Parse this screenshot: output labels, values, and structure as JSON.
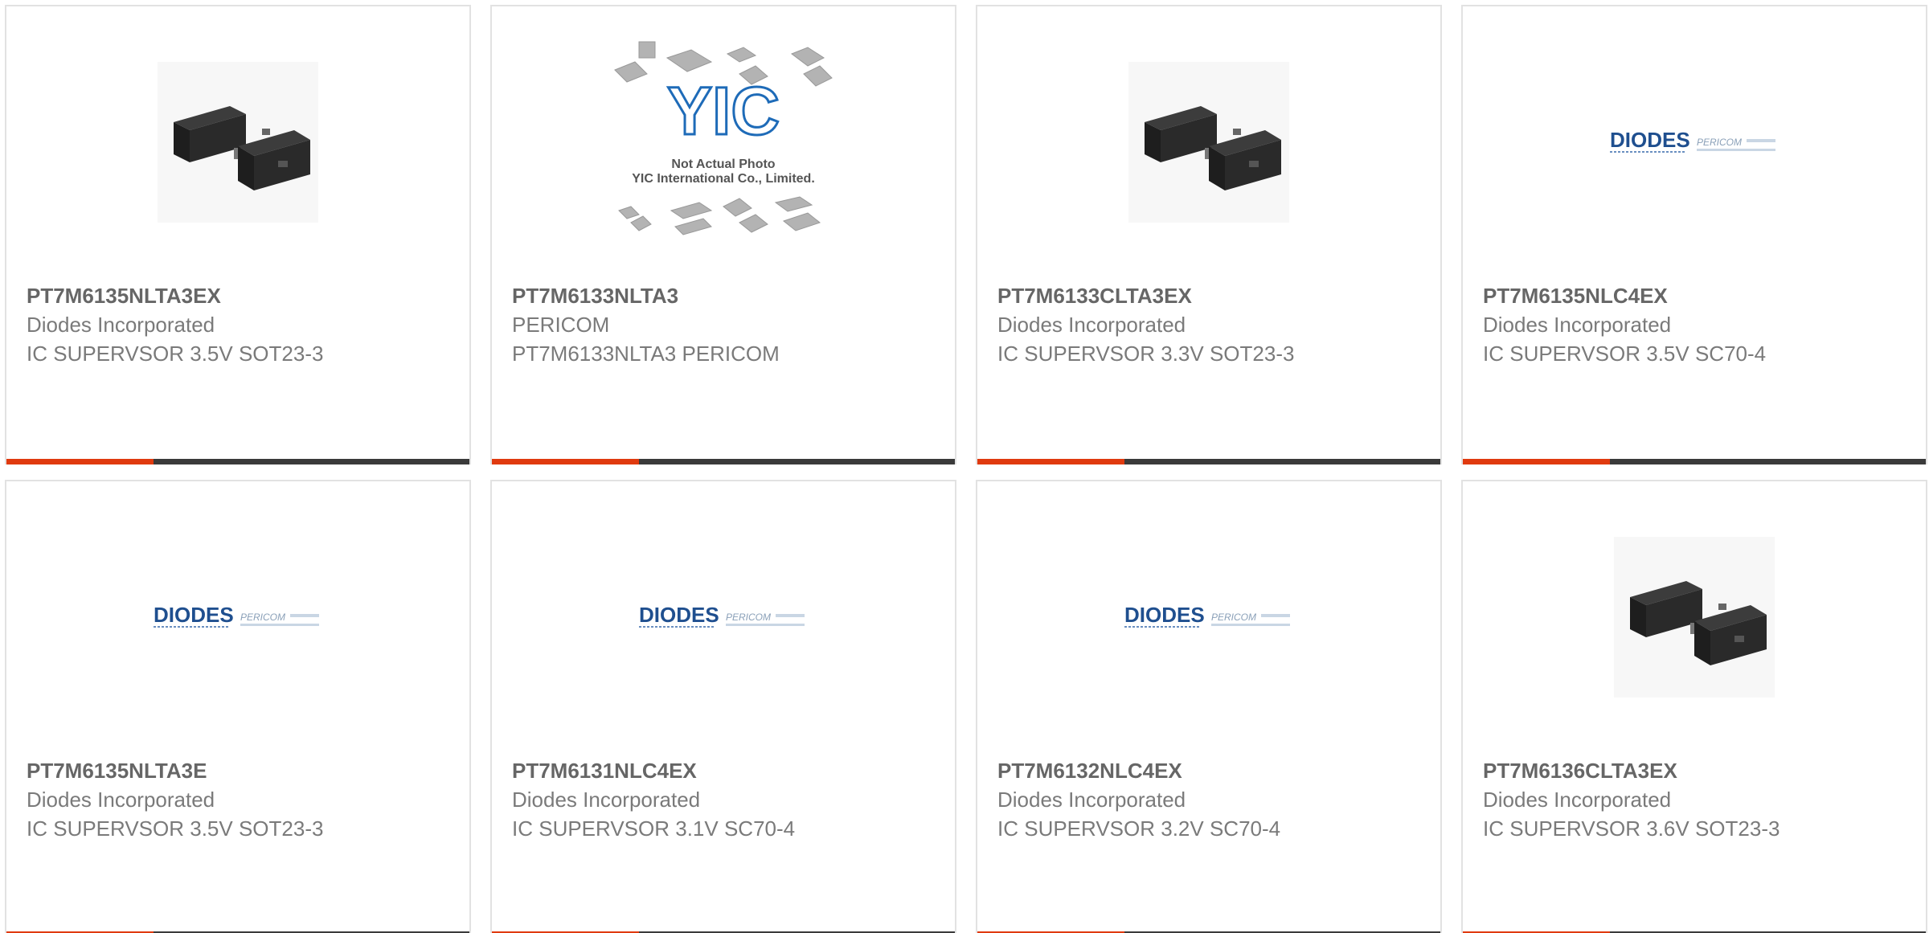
{
  "cards": [
    {
      "part_number": "PT7M6135NLTA3EX",
      "manufacturer": "Diodes Incorporated",
      "description": "IC SUPERVSOR 3.5V SOT23-3",
      "image": "sot23-package-photo"
    },
    {
      "part_number": "PT7M6133NLTA3",
      "manufacturer": "PERICOM",
      "description": "PT7M6133NLTA3 PERICOM",
      "image": "placeholder-not-actual-photo",
      "placeholder": {
        "logo": "YIC",
        "line1": "Not Actual Photo",
        "line2": "YIC International Co., Limited."
      }
    },
    {
      "part_number": "PT7M6133CLTA3EX",
      "manufacturer": "Diodes Incorporated",
      "description": "IC SUPERVSOR 3.3V SOT23-3",
      "image": "sot23-package-photo"
    },
    {
      "part_number": "PT7M6135NLC4EX",
      "manufacturer": "Diodes Incorporated",
      "description": "IC SUPERVSOR 3.5V SC70-4",
      "image": "diodes-pericom-logo"
    },
    {
      "part_number": "PT7M6135NLTA3E",
      "manufacturer": "Diodes Incorporated",
      "description": "IC SUPERVSOR 3.5V SOT23-3",
      "image": "diodes-pericom-logo"
    },
    {
      "part_number": "PT7M6131NLC4EX",
      "manufacturer": "Diodes Incorporated",
      "description": "IC SUPERVSOR 3.1V SC70-4",
      "image": "diodes-pericom-logo"
    },
    {
      "part_number": "PT7M6132NLC4EX",
      "manufacturer": "Diodes Incorporated",
      "description": "IC SUPERVSOR 3.2V SC70-4",
      "image": "diodes-pericom-logo"
    },
    {
      "part_number": "PT7M6136CLTA3EX",
      "manufacturer": "Diodes Incorporated",
      "description": "IC SUPERVSOR 3.6V SOT23-3",
      "image": "sot23-package-photo"
    }
  ],
  "logo_text": {
    "diodes": "DIODES",
    "pericom": "PERICOM"
  },
  "colors": {
    "accent": "#e03a0f",
    "bar": "#3a3a3a",
    "text": "#7a7a7a",
    "title": "#666666",
    "logo_blue": "#1f4f8f"
  }
}
